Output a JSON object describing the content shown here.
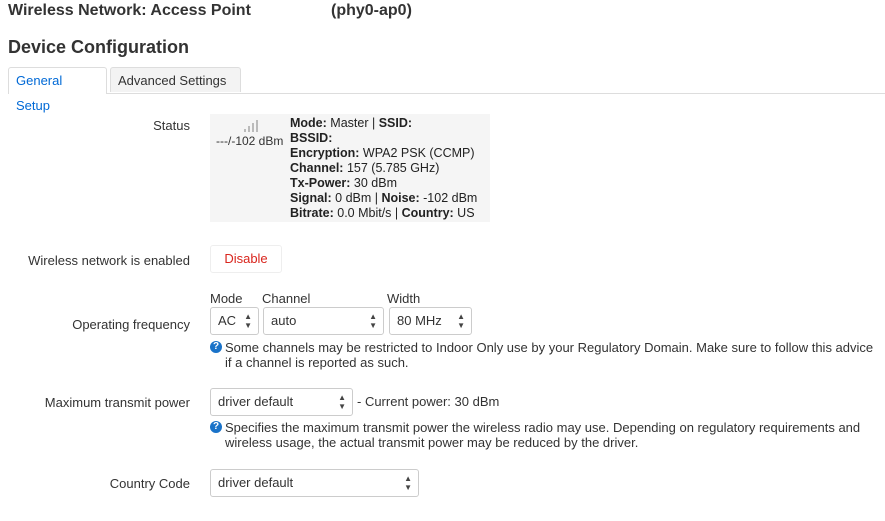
{
  "header": {
    "title": "Wireless Network: Access Point",
    "interface": "(phy0-ap0)"
  },
  "section_title": "Device Configuration",
  "tabs": [
    {
      "label": "General Setup",
      "active": true
    },
    {
      "label": "Advanced Settings",
      "active": false
    }
  ],
  "status": {
    "label": "Status",
    "signal_text": "---/-102 dBm",
    "mode_key": "Mode:",
    "mode_val": " Master | ",
    "ssid_key": "SSID:",
    "bssid_key": "BSSID:",
    "encryption_key": "Encryption:",
    "encryption_val": " WPA2 PSK (CCMP)",
    "channel_key": "Channel:",
    "channel_val": " 157 (5.785 GHz)",
    "txpower_key": "Tx-Power:",
    "txpower_val": " 30 dBm",
    "signal_key": "Signal:",
    "signal_val": " 0 dBm | ",
    "noise_key": "Noise:",
    "noise_val": " -102 dBm",
    "bitrate_key": "Bitrate:",
    "bitrate_val": " 0.0 Mbit/s | ",
    "country_key": "Country:",
    "country_val": " US"
  },
  "enabled": {
    "label": "Wireless network is enabled",
    "button": "Disable"
  },
  "frequency": {
    "label": "Operating frequency",
    "mode_label": "Mode",
    "channel_label": "Channel",
    "width_label": "Width",
    "mode_value": "AC",
    "channel_value": "auto",
    "width_value": "80 MHz",
    "help_line1": "Some channels may be restricted to Indoor Only use by your Regulatory Domain. Make sure to follow this advice",
    "help_line2": "if a channel is reported as such."
  },
  "txpower": {
    "label": "Maximum transmit power",
    "value": "driver default",
    "current": "- Current power: 30 dBm",
    "help_line1": "Specifies the maximum transmit power the wireless radio may use. Depending on regulatory requirements and",
    "help_line2": "wireless usage, the actual transmit power may be reduced by the driver."
  },
  "country": {
    "label": "Country Code",
    "value": "driver default"
  },
  "icons": {
    "signal": "signal-bars-icon",
    "help": "question-circle-icon",
    "select_arrow": "updown-arrows-icon"
  },
  "colors": {
    "tab_active": "#0069d6",
    "disable_text": "#d9251d",
    "help_icon": "#1a73c9"
  }
}
